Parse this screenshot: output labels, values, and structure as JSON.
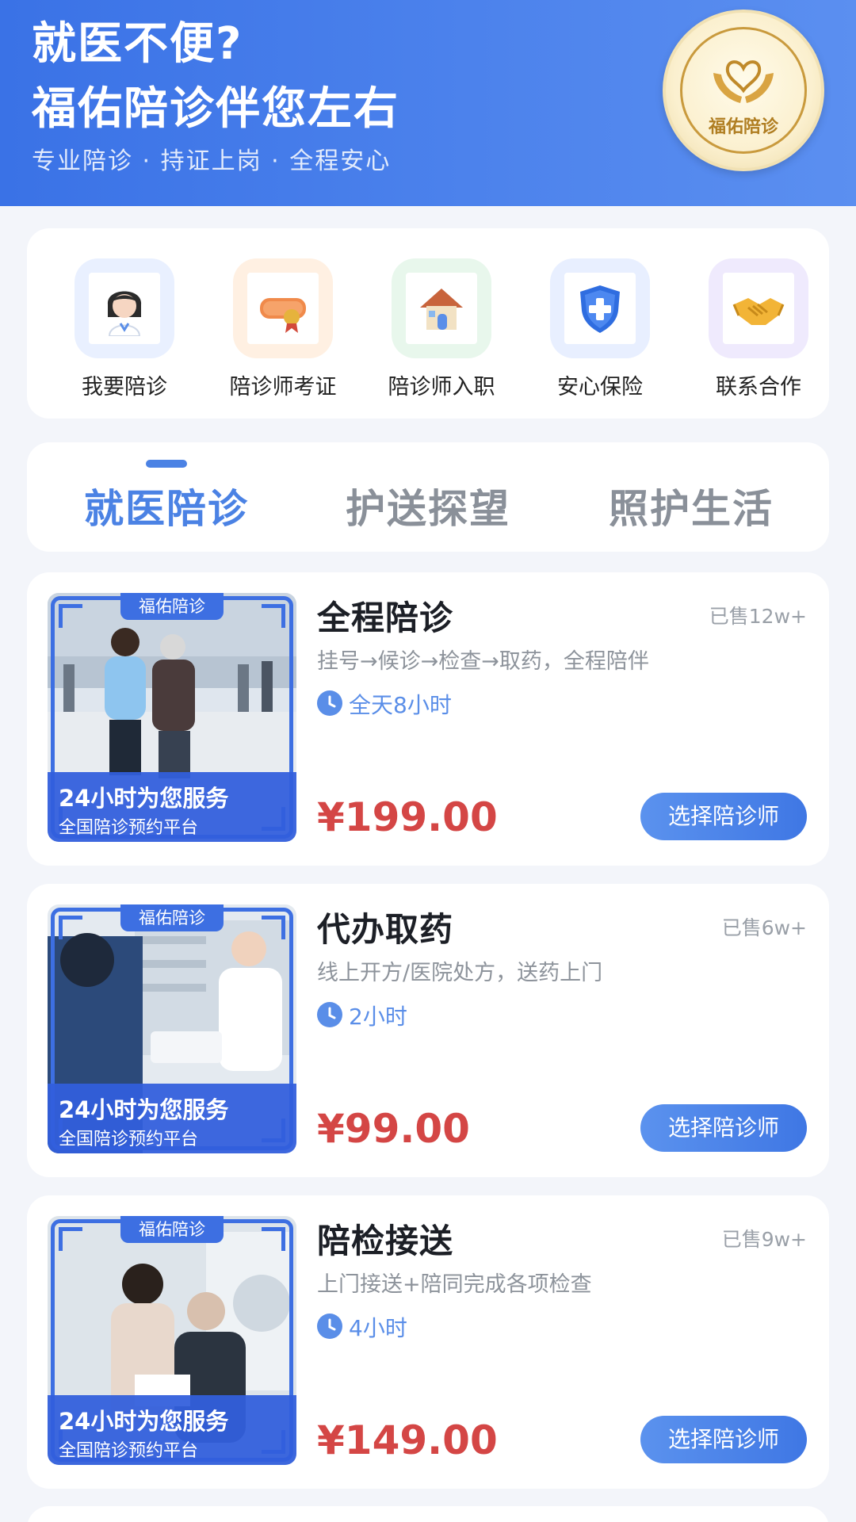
{
  "header": {
    "title_line1": "就医不便?",
    "title_line2": "福佑陪诊伴您左右",
    "subtitle": "专业陪诊 · 持证上岗 · 全程安心",
    "logo_text": "福佑陪诊"
  },
  "quick_menu": [
    {
      "label": "我要陪诊",
      "icon": "nurse-avatar-icon",
      "bg": "#e9f0ff"
    },
    {
      "label": "陪诊师考证",
      "icon": "certificate-scroll-icon",
      "bg": "#fff0e2"
    },
    {
      "label": "陪诊师入职",
      "icon": "house-icon",
      "bg": "#e8f7ec"
    },
    {
      "label": "安心保险",
      "icon": "shield-cross-icon",
      "bg": "#e8efff"
    },
    {
      "label": "联系合作",
      "icon": "handshake-icon",
      "bg": "#efeafd"
    }
  ],
  "tabs": [
    {
      "label": "就医陪诊",
      "active": true
    },
    {
      "label": "护送探望",
      "active": false
    },
    {
      "label": "照护生活",
      "active": false
    }
  ],
  "services": [
    {
      "title": "全程陪诊",
      "sold": "已售12w+",
      "desc": "挂号→候诊→检查→取药，全程陪伴",
      "time": "全天8小时",
      "price": "¥199.00",
      "button": "选择陪诊师",
      "badge": "福佑陪诊",
      "banner_title": "24小时为您服务",
      "banner_sub": "全国陪诊预约平台"
    },
    {
      "title": "代办取药",
      "sold": "已售6w+",
      "desc": "线上开方/医院处方，送药上门",
      "time": "2小时",
      "price": "¥99.00",
      "button": "选择陪诊师",
      "badge": "福佑陪诊",
      "banner_title": "24小时为您服务",
      "banner_sub": "全国陪诊预约平台"
    },
    {
      "title": "陪检接送",
      "sold": "已售9w+",
      "desc": "上门接送+陪同完成各项检查",
      "time": "4小时",
      "price": "¥149.00",
      "button": "选择陪诊师",
      "badge": "福佑陪诊",
      "banner_title": "24小时为您服务",
      "banner_sub": "全国陪诊预约平台"
    }
  ],
  "colors": {
    "primary": "#4b82e4",
    "price": "#d44645",
    "header_bg": "#3a72e6"
  }
}
